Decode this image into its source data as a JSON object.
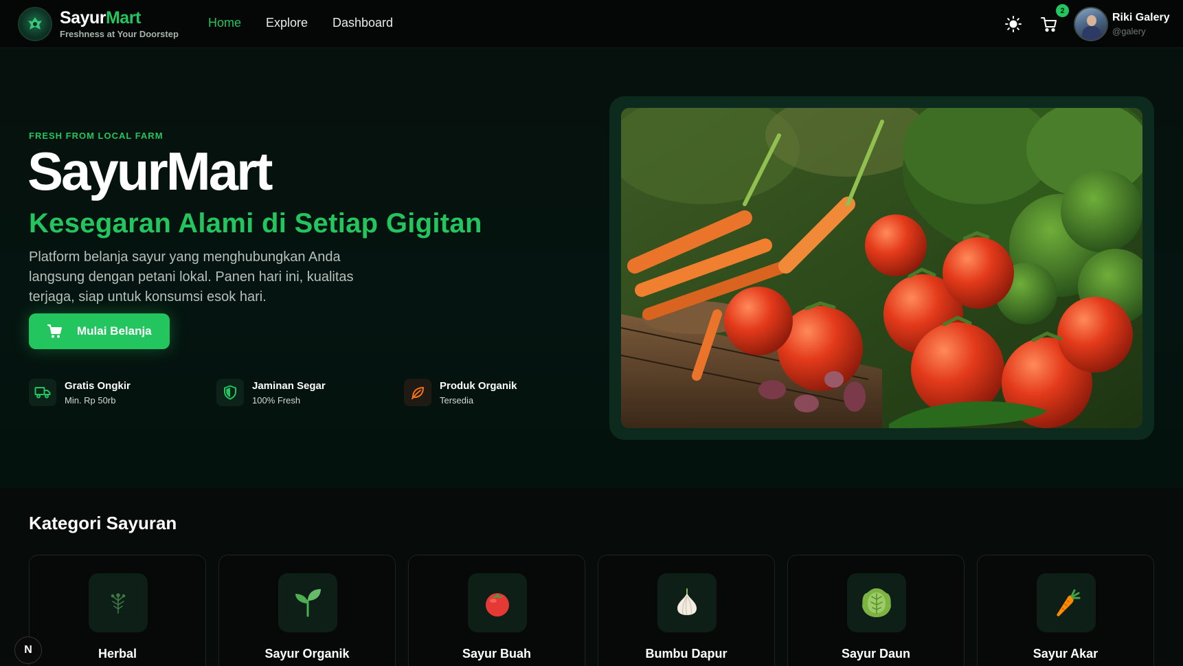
{
  "brand": {
    "name_part1": "Sayur",
    "name_part2": "Mart",
    "tagline": "Freshness at Your Doorstep"
  },
  "nav": {
    "links": [
      {
        "label": "Home",
        "active": true
      },
      {
        "label": "Explore",
        "active": false
      },
      {
        "label": "Dashboard",
        "active": false
      }
    ],
    "cart_count": "2",
    "user": {
      "name": "Riki Galery",
      "handle": "@galery"
    }
  },
  "hero": {
    "eyebrow": "FRESH FROM LOCAL FARM",
    "title": "SayurMart",
    "subtitle": "Kesegaran Alami di Setiap Gigitan",
    "description": "Platform belanja sayur yang menghubungkan Anda langsung dengan petani lokal. Panen hari ini, kualitas terjaga, siap untuk konsumsi esok hari.",
    "cta_label": "Mulai Belanja",
    "features": [
      {
        "icon": "truck-icon",
        "title": "Gratis Ongkir",
        "subtitle": "Min. Rp 50rb"
      },
      {
        "icon": "shield-icon",
        "title": "Jaminan Segar",
        "subtitle": "100% Fresh"
      },
      {
        "icon": "leaf-icon",
        "title": "Produk Organik",
        "subtitle": "Tersedia"
      }
    ]
  },
  "categories": {
    "title": "Kategori Sayuran",
    "items": [
      {
        "label": "Herbal",
        "icon": "herb-icon"
      },
      {
        "label": "Sayur Organik",
        "icon": "seedling-icon"
      },
      {
        "label": "Sayur Buah",
        "icon": "tomato-icon"
      },
      {
        "label": "Bumbu Dapur",
        "icon": "garlic-icon"
      },
      {
        "label": "Sayur Daun",
        "icon": "lettuce-icon"
      },
      {
        "label": "Sayur Akar",
        "icon": "carrot-icon"
      }
    ]
  },
  "colors": {
    "accent": "#22c55e",
    "background": "#070b09"
  },
  "corner_badge": "N"
}
